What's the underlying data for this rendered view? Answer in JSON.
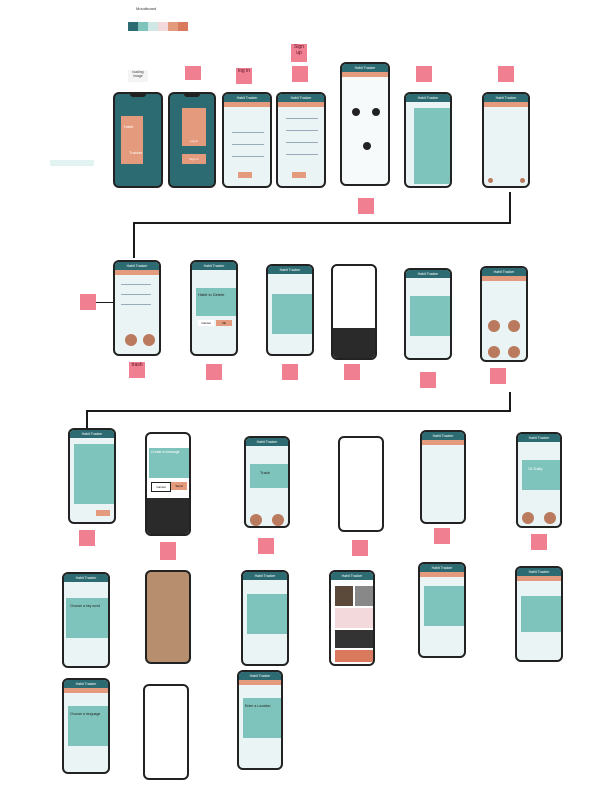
{
  "palette": {
    "title": "Moodboard",
    "colors": [
      "#2d6b72",
      "#7fc4bc",
      "#cfe8e6",
      "#f3d9dc",
      "#e49a7c",
      "#d97a5e"
    ]
  },
  "row1_labels": {
    "loading": "loading image",
    "sign_up": "Sign up",
    "log_in": "log in"
  },
  "row1_splash_text": {
    "line1": "Habit",
    "line2": "Tracker"
  },
  "row1_menu_buttons": {
    "b1": "Log in",
    "b2": "Sign in"
  },
  "app_title": "Habit Tracker",
  "row2_notes": {
    "trash": "trash",
    "delete_title": "Habit to Delete",
    "cancel": "Cancel",
    "ok": "Ok"
  },
  "row3_dialog": {
    "title": "Create a message",
    "cancel": "Cancel",
    "send": "Send"
  },
  "row3_card": {
    "title": "Track"
  },
  "row3_history": {
    "title": "Or Daily"
  },
  "row4_popup": {
    "title": "Choose a key word"
  },
  "row5_language": {
    "title": "Choose a language"
  },
  "row5_form": {
    "title": "Enter a Location"
  }
}
